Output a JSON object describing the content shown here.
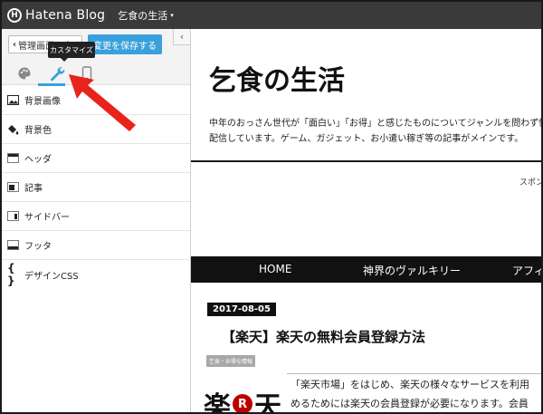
{
  "topbar": {
    "logo_mark": "H",
    "logo_text": "Hatena Blog",
    "blog_name": "乞食の生活",
    "caret": "▾"
  },
  "sidebar": {
    "back_label": "管理画面に戻る",
    "back_chevron": "‹",
    "save_label": "変更を保存する",
    "collapse_glyph": "‹",
    "tooltip": "カスタマイズ",
    "tabs": [
      {
        "icon": "palette-icon"
      },
      {
        "icon": "wrench-icon",
        "active": true
      },
      {
        "icon": "smartphone-icon"
      }
    ],
    "menu": [
      {
        "label": "背景画像",
        "icon": "image-icon"
      },
      {
        "label": "背景色",
        "icon": "paint-bucket-icon"
      },
      {
        "label": "ヘッダ",
        "icon": "header-layout-icon"
      },
      {
        "label": "記事",
        "icon": "article-layout-icon"
      },
      {
        "label": "サイドバー",
        "icon": "sidebar-layout-icon"
      },
      {
        "label": "フッタ",
        "icon": "footer-layout-icon"
      },
      {
        "label": "デザインCSS",
        "icon": "code-braces-icon"
      }
    ]
  },
  "preview": {
    "blog_title": "乞食の生活",
    "description_line1": "中年のおっさん世代が「面白い」「お得」と感じたものについてジャンルを問わず情報",
    "description_line2": "配信しています。ゲーム、ガジェット、お小遣い稼ぎ等の記事がメインです。",
    "sponsor": "スポン",
    "nav": [
      "HOME",
      "神界のヴァルキリー",
      "アフィ"
    ],
    "post": {
      "date": "2017-08-05",
      "title": "【楽天】楽天の無料会員登録方法",
      "category": "乞食・お得な情報",
      "body_line1": "「楽天市場」をはじめ、楽天の様々なサービスを利用",
      "body_line2": "めるためには楽天の会員登録が必要になります。会員",
      "logo_left": "楽",
      "logo_r": "R",
      "logo_right": "天"
    }
  },
  "colors": {
    "topbar": "#3a3a3a",
    "accent": "#3aa0dc",
    "arrow": "#e8231b",
    "nav_bg": "#111111",
    "rakuten": "#bf0000"
  }
}
